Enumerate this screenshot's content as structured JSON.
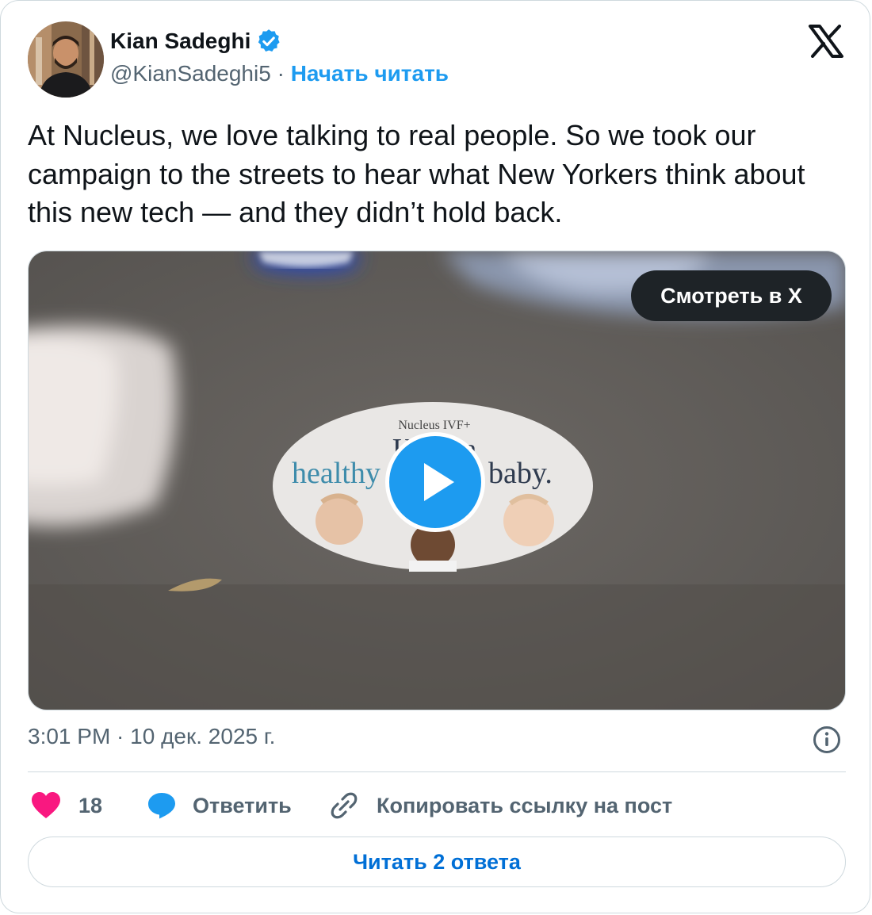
{
  "author": {
    "name": "Kian Sadeghi",
    "handle": "@KianSadeghi5",
    "separator": "·",
    "follow_label": "Начать читать"
  },
  "tweet": {
    "text": "At Nucleus, we love talking to real people. So we took our campaign to the streets to hear what New Yorkers think about this new tech — and they didn’t hold back."
  },
  "media": {
    "watch_label": "Смотреть в X",
    "sticker_brand": "Nucleus IVF+",
    "sticker_line1": "Have a",
    "sticker_line2_a": "healthy",
    "sticker_line2_b": "baby."
  },
  "meta": {
    "timestamp": "3:01 PM · 10 дек. 2025 г."
  },
  "actions": {
    "likes_count": "18",
    "reply_label": "Ответить",
    "copy_link_label": "Копировать ссылку на пост"
  },
  "read_replies_label": "Читать 2 ответа",
  "colors": {
    "accent": "#1d9bf0",
    "like": "#f91880",
    "text": "#0f1419",
    "secondary": "#536471"
  },
  "icons": [
    "verified-badge-icon",
    "x-logo-icon",
    "play-icon",
    "info-icon",
    "heart-icon",
    "reply-bubble-icon",
    "link-icon"
  ]
}
